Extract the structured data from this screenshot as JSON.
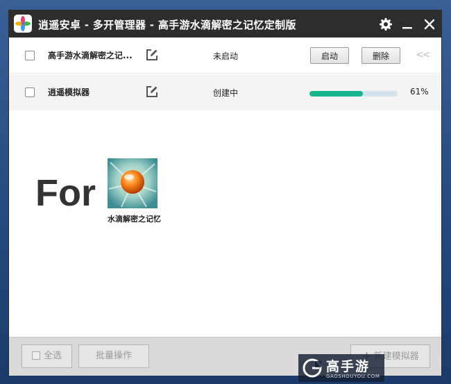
{
  "window": {
    "title": "逍遥安卓 - 多开管理器 - 高手游水滴解密之记忆定制版"
  },
  "emulators": [
    {
      "name": "高手游水滴解密之记...",
      "status": "未启动",
      "start_label": "启动",
      "delete_label": "删除",
      "collapse_glyph": "<<"
    },
    {
      "name": "逍遥模拟器",
      "status": "创建中",
      "progress": 0.61,
      "progress_label": "61%"
    }
  ],
  "promo": {
    "for_text": "For",
    "game_label": "水滴解密之记忆"
  },
  "footer": {
    "select_all_label": "全选",
    "batch_label": "批量操作",
    "new_emulator_label": "新建模拟器"
  },
  "watermark": {
    "brand_cn": "高手游",
    "brand_en": "GAOSHOUYOU.COM"
  },
  "colors": {
    "titlebar": "#2d2d2d",
    "progress_fill": "#18b48d",
    "progress_track": "#d3e3ee",
    "footer": "#dadada"
  },
  "icons": {
    "app": "xiaoyao-app-icon",
    "settings": "gear-icon",
    "minimize": "minimize-icon",
    "close": "close-icon",
    "edit": "edit-icon",
    "game": "water-drop-game-icon",
    "watermark_logo": "gaoshouyou-logo-icon"
  }
}
